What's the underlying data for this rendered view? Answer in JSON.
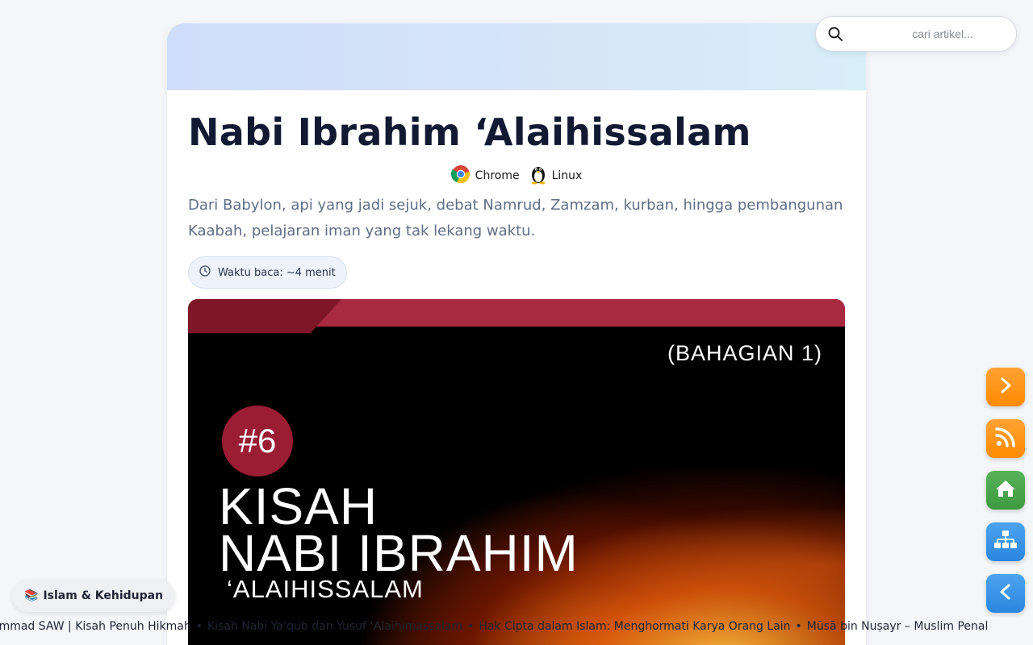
{
  "search": {
    "placeholder": "cari artikel..."
  },
  "article": {
    "title": "Nabi Ibrahim ‘Alaihissalam",
    "environment": [
      {
        "label": "Chrome",
        "icon": "chrome-icon"
      },
      {
        "label": "Linux",
        "icon": "linux-penguin-icon"
      }
    ],
    "subtitle": "Dari Babylon, api yang jadi sejuk, debat Namrud, Zamzam, kurban, hingga pembangunan Kaabah, pelajaran iman yang tak lekang waktu.",
    "reading_time": "Waktu baca: ~4 menit",
    "cover": {
      "part": "(BAHAGIAN 1)",
      "number": "#6",
      "title_line1": "KISAH",
      "title_line2": "NABI IBRAHIM",
      "subtitle": "‘ALAIHISSALAM"
    }
  },
  "side_buttons": [
    {
      "name": "next-button",
      "icon": "chevron-right-icon",
      "color": "#ff9500"
    },
    {
      "name": "rss-button",
      "icon": "rss-icon",
      "color": "#ff9500"
    },
    {
      "name": "home-button",
      "icon": "home-icon",
      "color": "#46a349"
    },
    {
      "name": "sitemap-button",
      "icon": "sitemap-icon",
      "color": "#3a95e8"
    },
    {
      "name": "back-button",
      "icon": "chevron-left-icon",
      "color": "#3a95e8"
    }
  ],
  "category": {
    "emoji": "📚",
    "label": "Islam & Kehidupan"
  },
  "ticker": [
    "ammad SAW | Kisah Penuh Hikmah",
    "Kisah Nabi Ya’qub dan Yusuf ‘Alaihimassalam",
    "Hak Cipta dalam Islam: Menghormati Karya Orang Lain",
    "Mūsā bin Nuṣayr – Muslim Penal"
  ],
  "ticker_separator": "•",
  "colors": {
    "accent_orange": "#ff9500",
    "accent_green": "#46a349",
    "accent_blue": "#3a95e8",
    "cover_red": "#a72a40",
    "title": "#121a33"
  }
}
